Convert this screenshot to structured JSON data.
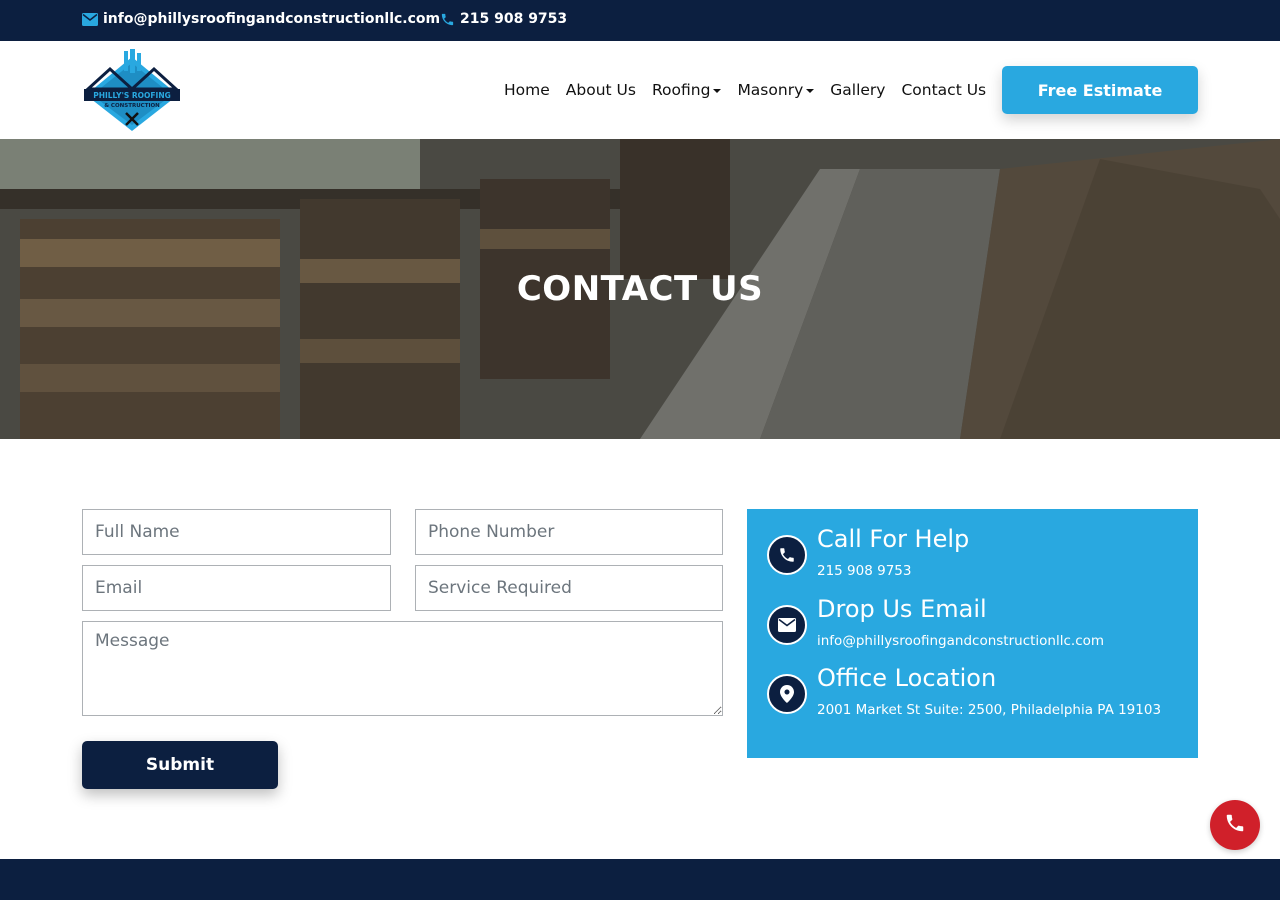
{
  "topbar": {
    "email": "info@phillysroofingandconstructionllc.com",
    "phone": "215 908 9753"
  },
  "header": {
    "logo_alt": "Philly's Roofing & Construction",
    "logo_line1": "PHILLY'S ROOFING",
    "logo_line2": "& CONSTRUCTION",
    "nav": [
      {
        "label": "Home"
      },
      {
        "label": "About Us"
      },
      {
        "label": "Roofing"
      },
      {
        "label": "Masonry"
      },
      {
        "label": "Gallery"
      },
      {
        "label": "Contact Us"
      }
    ],
    "cta_label": "Free Estimate"
  },
  "hero": {
    "title": "CONTACT US"
  },
  "form": {
    "full_name_placeholder": "Full Name",
    "phone_placeholder": "Phone Number",
    "email_placeholder": "Email",
    "service_placeholder": "Service Required",
    "message_placeholder": "Message",
    "submit_label": "Submit"
  },
  "info": {
    "items": [
      {
        "title": "Call For Help",
        "text": "215 908 9753",
        "icon": "phone-icon"
      },
      {
        "title": "Drop Us Email",
        "text": "info@phillysroofingandconstructionllc.com",
        "icon": "envelope-icon"
      },
      {
        "title": "Office Location",
        "text": "2001 Market St Suite: 2500, Philadelphia PA 19103",
        "icon": "map-marker-icon"
      }
    ]
  },
  "colors": {
    "navy": "#0c1f40",
    "accent": "#29a8e0",
    "call_button": "#d0202a"
  }
}
